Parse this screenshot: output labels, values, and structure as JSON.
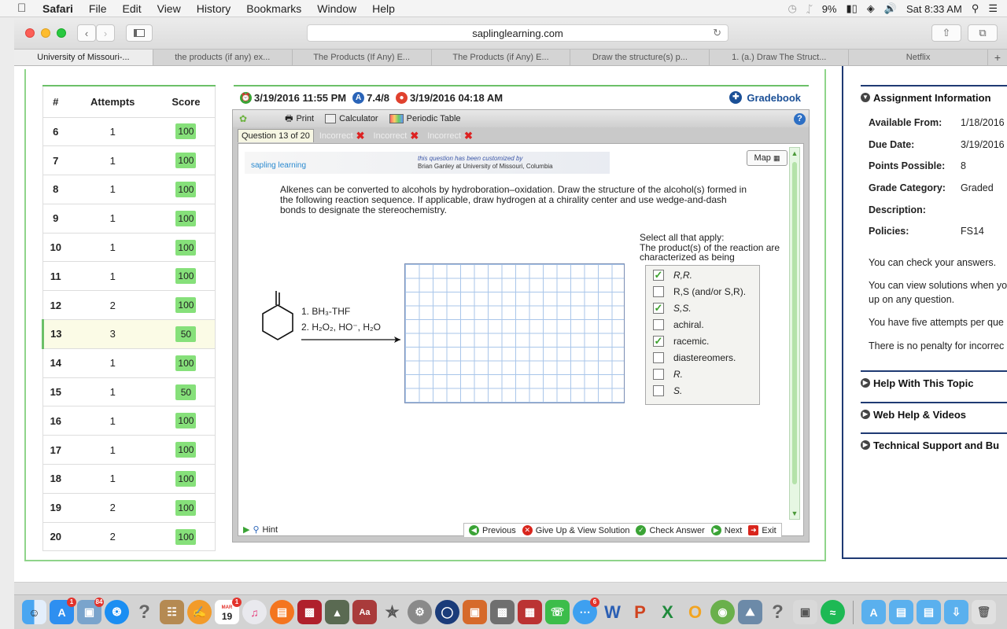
{
  "menubar": {
    "app": "Safari",
    "items": [
      "File",
      "Edit",
      "View",
      "History",
      "Bookmarks",
      "Window",
      "Help"
    ],
    "battery": "9%",
    "clock": "Sat 8:33 AM"
  },
  "browser": {
    "url": "saplinglearning.com",
    "tabs": [
      "University of Missouri-...",
      "the products (if any) ex...",
      "The Products (If Any) E...",
      "The Products (if Any) E...",
      "Draw the structure(s) p...",
      "1. (a.) Draw The Struct...",
      "Netflix"
    ],
    "new_tab": "+"
  },
  "scores": {
    "headers": [
      "#",
      "Attempts",
      "Score"
    ],
    "rows": [
      {
        "num": "6",
        "attempts": "1",
        "score": "100"
      },
      {
        "num": "7",
        "attempts": "1",
        "score": "100"
      },
      {
        "num": "8",
        "attempts": "1",
        "score": "100"
      },
      {
        "num": "9",
        "attempts": "1",
        "score": "100"
      },
      {
        "num": "10",
        "attempts": "1",
        "score": "100"
      },
      {
        "num": "11",
        "attempts": "1",
        "score": "100"
      },
      {
        "num": "12",
        "attempts": "2",
        "score": "100"
      },
      {
        "num": "13",
        "attempts": "3",
        "score": "50"
      },
      {
        "num": "14",
        "attempts": "1",
        "score": "100"
      },
      {
        "num": "15",
        "attempts": "1",
        "score": "50"
      },
      {
        "num": "16",
        "attempts": "1",
        "score": "100"
      },
      {
        "num": "17",
        "attempts": "1",
        "score": "100"
      },
      {
        "num": "18",
        "attempts": "1",
        "score": "100"
      },
      {
        "num": "19",
        "attempts": "2",
        "score": "100"
      },
      {
        "num": "20",
        "attempts": "2",
        "score": "100"
      }
    ]
  },
  "question_header": {
    "due": "3/19/2016 11:55 PM",
    "points": "7.4/8",
    "submitted": "3/19/2016 04:18 AM",
    "gradebook": "Gradebook"
  },
  "tools": {
    "print": "Print",
    "calculator": "Calculator",
    "periodic_table": "Periodic Table"
  },
  "question_tabs": {
    "current": "Question 13 of 20",
    "attempts": [
      "Incorrect",
      "Incorrect",
      "Incorrect"
    ]
  },
  "banner": {
    "logo": "sapling learning",
    "customized": "this question has been customized by",
    "author": "Brian Ganley at University of Missouri, Columbia",
    "map": "Map"
  },
  "question": {
    "text": "Alkenes can be converted to alcohols by hydroboration–oxidation. Draw the structure of the alcohol(s) formed in the following reaction sequence. If applicable, draw hydrogen at a chirality center and use wedge-and-dash bonds to designate the stereochemistry.",
    "step1": "1. BH₃-THF",
    "step2": "2. H₂O₂, HO⁻, H₂O",
    "select_all": "Select all that apply:",
    "select_prompt": "The product(s) of the reaction are characterized as being"
  },
  "options": [
    {
      "label": "R,R.",
      "checked": true
    },
    {
      "label": "R,S (and/or S,R).",
      "checked": false
    },
    {
      "label": "S,S.",
      "checked": true
    },
    {
      "label": "achiral.",
      "checked": false
    },
    {
      "label": "racemic.",
      "checked": true
    },
    {
      "label": "diastereomers.",
      "checked": false
    },
    {
      "label": "R.",
      "checked": false
    },
    {
      "label": "S.",
      "checked": false
    }
  ],
  "footer": {
    "hint": "Hint",
    "previous": "Previous",
    "give_up": "Give Up & View Solution",
    "check": "Check Answer",
    "next": "Next",
    "exit": "Exit"
  },
  "assignment": {
    "title": "Assignment Information",
    "available_label": "Available From:",
    "available": "1/18/2016",
    "due_label": "Due Date:",
    "due": "3/19/2016",
    "points_label": "Points Possible:",
    "points": "8",
    "category_label": "Grade Category:",
    "category": "Graded",
    "description_label": "Description:",
    "policies_label": "Policies:",
    "policies": "FS14",
    "p1": "You can check your answers.",
    "p2a": "You can view solutions when yo",
    "p2b": "up on any question.",
    "p3": "You have five attempts per que",
    "p4": "There is no penalty for incorrec",
    "help_topic": "Help With This Topic",
    "web_help": "Web Help & Videos",
    "tech": "Technical Support and Bu"
  },
  "dock": {
    "calendar_day": "19",
    "calendar_month": "MAR",
    "badges": [
      "1",
      "84",
      "1",
      "6"
    ]
  },
  "colors": {
    "green_accent": "#6cc068",
    "score_badge": "#86e07a",
    "navy": "#1f3a73"
  }
}
